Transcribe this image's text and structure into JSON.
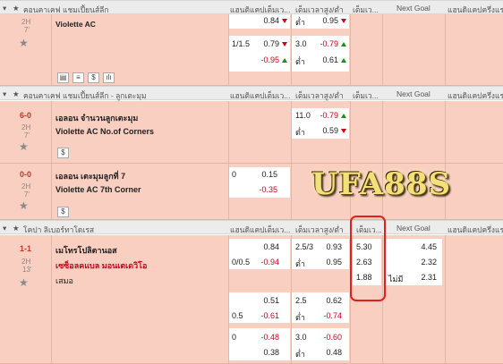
{
  "headers": {
    "h1": {
      "league": "คอนคาเคฟ แชมเปี้ยนส์ลีก",
      "handicap": "แฮนดิแคปเต็มเว...",
      "ou": "เต็มเวลาสูง/ต่ำ",
      "x12": "เต็มเว...",
      "next_goal": "Next Goal",
      "ht_handicap": "แฮนดิแคปครึ่งแร"
    },
    "h2": {
      "league": "คอนคาเคฟ แชมเปี้ยนส์ลีก - ลูกเตะมุม",
      "handicap": "แฮนดิแคปเต็มเว...",
      "ou": "เต็มเวลาสูง/ต่ำ",
      "x12": "เต็มเว...",
      "next_goal": "Next Goal",
      "ht_handicap": "แฮนดิแคปครึ่งแร"
    },
    "h3": {
      "league": "โคปา ลิเบอร์ทาโดเรส",
      "handicap": "แฮนดิแคปเต็มเว...",
      "ou": "เต็มเวลาสูง/ต่ำ",
      "x12": "เต็มเว...",
      "next_goal": "Next Goal",
      "ht_handicap": "แฮนดิแคปครึ่งแร"
    }
  },
  "m1": {
    "period": "2H",
    "minute": "7'",
    "team": "Violette AC",
    "l1": {
      "hdp_odds": "0.84",
      "ou_label": "ต่ำ",
      "ou_odds": "0.95"
    },
    "l2": {
      "hdp_line": "1/1.5",
      "hdp_odds": "0.79",
      "ou_line": "3.0",
      "ou_odds": "-0.79"
    },
    "l3": {
      "hdp_odds": "-0.95",
      "ou_label": "ต่ำ",
      "ou_odds": "0.61"
    }
  },
  "m2": {
    "score": "6-0",
    "period": "2H",
    "minute": "7'",
    "team1": "เอลอน จำนวนลูกเตะมุม",
    "team2": "Violette AC No.of Corners",
    "ou_line": "11.0",
    "ou_over": "-0.79",
    "ou_label": "ต่ำ",
    "ou_under": "0.59"
  },
  "m3": {
    "score": "0-0",
    "period": "2H",
    "minute": "7'",
    "team1": "เอลอน เตะมุมลูกที่ 7",
    "team2": "Violette AC 7th Corner",
    "hdp_line": "0",
    "hdp_home": "0.15",
    "hdp_away": "-0.35"
  },
  "watermark": "UFA88S",
  "m4": {
    "score": "1-1",
    "period": "2H",
    "minute": "13'",
    "team1": "เมโทรโปลิตานอส",
    "team2": "เซซ็อลคแบล มอนเตเดวิโอ",
    "draw": "เสมอ",
    "r1": {
      "hdp_odds": "0.84",
      "ou_line": "2.5/3",
      "ou_odds": "0.93",
      "x12": "5.30",
      "ng": "4.45"
    },
    "r2": {
      "hdp_line": "0/0.5",
      "hdp_odds": "-0.94",
      "ou_label": "ต่ำ",
      "ou_odds": "0.95",
      "x12": "2.63",
      "ng": "2.32"
    },
    "r3": {
      "x12": "1.88",
      "ng_label": "ไม่มี",
      "ng": "2.31"
    },
    "s2r1": {
      "hdp_odds": "0.51",
      "ou_line": "2.5",
      "ou_odds": "0.62"
    },
    "s2r2": {
      "hdp_line": "0.5",
      "hdp_odds": "-0.61",
      "ou_label": "ต่ำ",
      "ou_odds": "-0.74"
    },
    "s3r1": {
      "hdp_line": "0",
      "hdp_odds": "-0.48",
      "ou_line": "3.0",
      "ou_odds": "-0.60"
    },
    "s3r2": {
      "hdp_odds": "0.38",
      "ou_label": "ต่ำ",
      "ou_odds": "0.48"
    }
  },
  "colors": {
    "row_bg": "#f9cfc1",
    "red": "#d0021b",
    "up": "#1a8f1a",
    "highlight": "#e0201b"
  }
}
